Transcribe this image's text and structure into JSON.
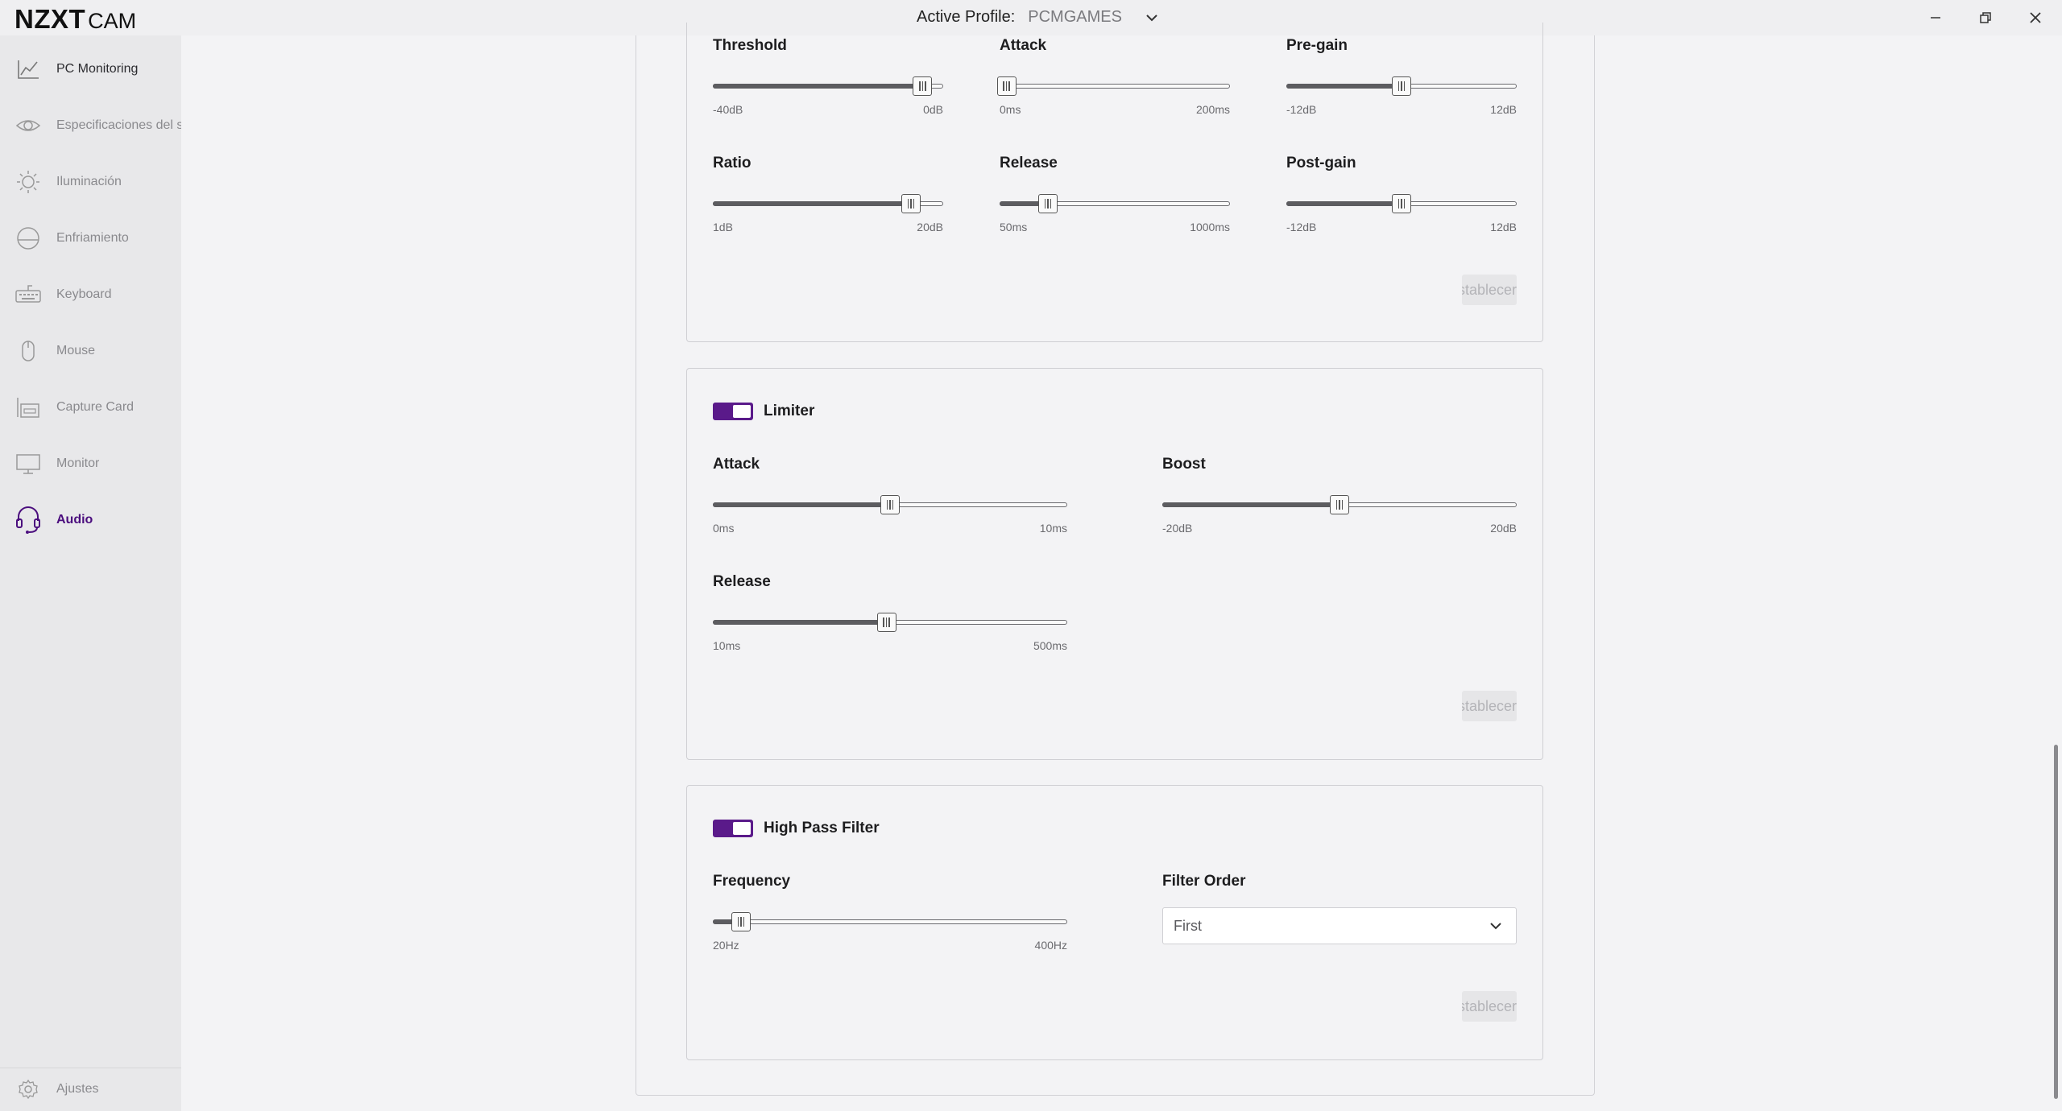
{
  "app": {
    "logo_main": "NZXT",
    "logo_sub": "CAM"
  },
  "header": {
    "profile_label": "Active Profile:",
    "profile_value": "PCMGAMES"
  },
  "sidebar": {
    "items": [
      {
        "label": "PC Monitoring",
        "icon": "chart-line-icon"
      },
      {
        "label": "Especificaciones del sistema",
        "icon": "eye-icon"
      },
      {
        "label": "Iluminación",
        "icon": "sun-icon"
      },
      {
        "label": "Enfriamiento",
        "icon": "cooling-icon"
      },
      {
        "label": "Keyboard",
        "icon": "keyboard-icon"
      },
      {
        "label": "Mouse",
        "icon": "mouse-icon"
      },
      {
        "label": "Capture Card",
        "icon": "capture-card-icon"
      },
      {
        "label": "Monitor",
        "icon": "monitor-icon"
      },
      {
        "label": "Audio",
        "icon": "headset-icon"
      }
    ],
    "settings_label": "Ajustes",
    "active_index": 8
  },
  "compressor": {
    "threshold": {
      "label": "Threshold",
      "min": "-40dB",
      "max": "0dB",
      "value_fraction": 0.91
    },
    "attack": {
      "label": "Attack",
      "min": "0ms",
      "max": "200ms",
      "value_fraction": 0.03
    },
    "pregain": {
      "label": "Pre-gain",
      "min": "-12dB",
      "max": "12dB",
      "value_fraction": 0.5
    },
    "ratio": {
      "label": "Ratio",
      "min": "1dB",
      "max": "20dB",
      "value_fraction": 0.86
    },
    "release": {
      "label": "Release",
      "min": "50ms",
      "max": "1000ms",
      "value_fraction": 0.21
    },
    "postgain": {
      "label": "Post-gain",
      "min": "-12dB",
      "max": "12dB",
      "value_fraction": 0.5
    },
    "reset_label": "Restablecer"
  },
  "limiter": {
    "title": "Limiter",
    "enabled": true,
    "attack": {
      "label": "Attack",
      "min": "0ms",
      "max": "10ms",
      "value_fraction": 0.5
    },
    "boost": {
      "label": "Boost",
      "min": "-20dB",
      "max": "20dB",
      "value_fraction": 0.5
    },
    "release": {
      "label": "Release",
      "min": "10ms",
      "max": "500ms",
      "value_fraction": 0.49
    },
    "reset_label": "Restablecer"
  },
  "highpass": {
    "title": "High Pass Filter",
    "enabled": true,
    "frequency": {
      "label": "Frequency",
      "min": "20Hz",
      "max": "400Hz",
      "value_fraction": 0.08
    },
    "filter_order": {
      "label": "Filter Order",
      "value": "First"
    },
    "reset_label": "Restablecer"
  },
  "colors": {
    "accent": "#4b0e7e",
    "toggle": "#5a1a8a"
  }
}
